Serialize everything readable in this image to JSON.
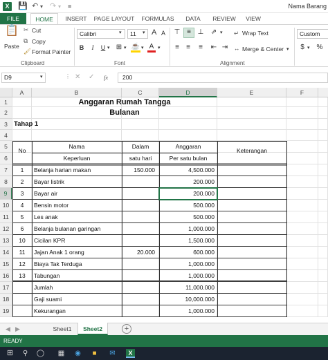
{
  "title_bar": {
    "app_icon": "X",
    "document_name": "Nama Barang"
  },
  "ribbon_tabs": [
    "FILE",
    "HOME",
    "INSERT",
    "PAGE LAYOUT",
    "FORMULAS",
    "DATA",
    "REVIEW",
    "VIEW"
  ],
  "active_tab": "HOME",
  "ribbon": {
    "cut": "Cut",
    "copy": "Copy",
    "format_painter": "Format Painter",
    "paste": "Paste",
    "clipboard": "Clipboard",
    "font_name": "Calibri",
    "font_size": "11",
    "font_group": "Font",
    "wrap_text": "Wrap Text",
    "merge_center": "Merge & Center",
    "alignment": "Alignment",
    "number_format": "Custom",
    "bold": "B",
    "italic": "I",
    "underline": "U",
    "grow_font": "A",
    "shrink_font": "A",
    "font_color": "A",
    "currency": "$",
    "percent": "%"
  },
  "formula_bar": {
    "name_box": "D9",
    "fx": "fx",
    "value": "200"
  },
  "columns": [
    "A",
    "B",
    "C",
    "D",
    "E",
    "F"
  ],
  "selected_column": "D",
  "rows": [
    "1",
    "2",
    "3",
    "4",
    "5",
    "6",
    "7",
    "8",
    "9",
    "10",
    "11",
    "12",
    "13",
    "14",
    "15",
    "16",
    "17",
    "18",
    "19"
  ],
  "selected_row": "9",
  "sheet": {
    "title1": "Anggaran Rumah Tangga",
    "title2": "Bulanan",
    "tahap": "Tahap 1",
    "headers": {
      "no": "No",
      "nama1": "Nama",
      "nama2": "Keperluan",
      "dalam1": "Dalam",
      "dalam2": "satu hari",
      "ang1": "Anggaran",
      "ang2": "Per satu bulan",
      "ket": "Keterangan"
    },
    "items": [
      {
        "no": "1",
        "name": "Belanja harian makan",
        "daily": "150.000",
        "monthly": "4,500.000"
      },
      {
        "no": "2",
        "name": "Bayar listrik",
        "daily": "",
        "monthly": "200.000"
      },
      {
        "no": "3",
        "name": "Bayar air",
        "daily": "",
        "monthly": "200.000"
      },
      {
        "no": "4",
        "name": "Bensin motor",
        "daily": "",
        "monthly": "500.000"
      },
      {
        "no": "5",
        "name": "Les anak",
        "daily": "",
        "monthly": "500.000"
      },
      {
        "no": "6",
        "name": "Belanja bulanan garingan",
        "daily": "",
        "monthly": "1,000.000"
      },
      {
        "no": "10",
        "name": "Cicilan KPR",
        "daily": "",
        "monthly": "1,500.000"
      },
      {
        "no": "11",
        "name": "Jajan Anak 1 orang",
        "daily": "20.000",
        "monthly": "600.000"
      },
      {
        "no": "12",
        "name": "Biaya Tak Terduga",
        "daily": "",
        "monthly": "1,000.000"
      },
      {
        "no": "13",
        "name": "Tabungan",
        "daily": "",
        "monthly": "1,000.000"
      }
    ],
    "summary": [
      {
        "label": "Jumlah",
        "value": "11,000.000"
      },
      {
        "label": "Gaji suami",
        "value": "10,000.000"
      },
      {
        "label": "Kekurangan",
        "value": "1,000.000"
      }
    ]
  },
  "sheet_tabs": [
    "Sheet1",
    "Sheet2"
  ],
  "active_sheet": "Sheet2",
  "add_sheet": "+",
  "status": "READY",
  "colors": {
    "excel_green": "#217346",
    "taskbar": "#1b2330"
  }
}
